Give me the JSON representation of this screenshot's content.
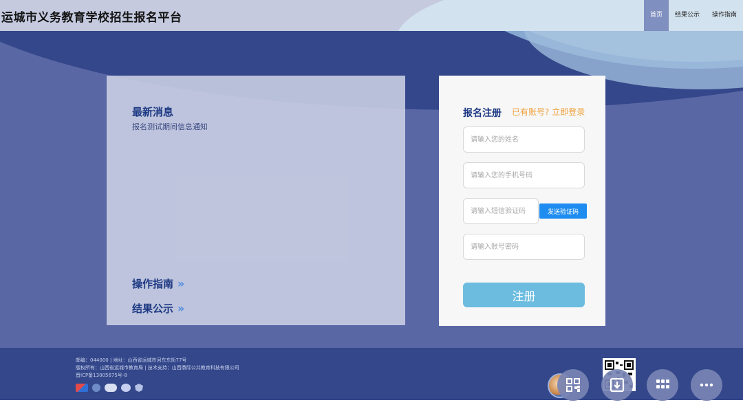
{
  "header": {
    "title": "运城市义务教育学校招生报名平台",
    "nav": [
      {
        "label": "首页",
        "active": true
      },
      {
        "label": "结果公示",
        "active": false
      },
      {
        "label": "操作指南",
        "active": false
      }
    ]
  },
  "news": {
    "title": "最新消息",
    "items": [
      "报名测试期间信息通知"
    ],
    "links": [
      {
        "label": "操作指南"
      },
      {
        "label": "结果公示"
      }
    ]
  },
  "register": {
    "title": "报名注册",
    "has_account": "已有账号?",
    "login_link": "立即登录",
    "name_placeholder": "请输入您的姓名",
    "phone_placeholder": "请输入您的手机号码",
    "sms_placeholder": "请输入短信验证码",
    "sms_button": "发送验证码",
    "password_placeholder": "请输入账号密码",
    "submit": "注册"
  },
  "footer": {
    "line1": "邮编：044000 | 地址：山西省运城市河东东街77号",
    "line2": "版权所有：山西省运城市教育局 | 技术支持：山西鼎际公共教育科技有限公司",
    "line3": "晋ICP备13005675号-8",
    "logos": [
      "brand-logo",
      "certification-logo",
      "iso-logo",
      "cnas-logo",
      "shield-logo"
    ]
  },
  "floating": {
    "icons": [
      "avatar",
      "qr-code-icon",
      "download-icon",
      "grid-apps-icon",
      "more-icon"
    ]
  },
  "colors": {
    "header_bg": "#cdd2e4",
    "primary_dark": "#34478a",
    "title_text": "#1e3a84",
    "accent_orange": "#f0a03c",
    "sms_button": "#1e8cf0",
    "submit_button": "#6cbce0"
  }
}
